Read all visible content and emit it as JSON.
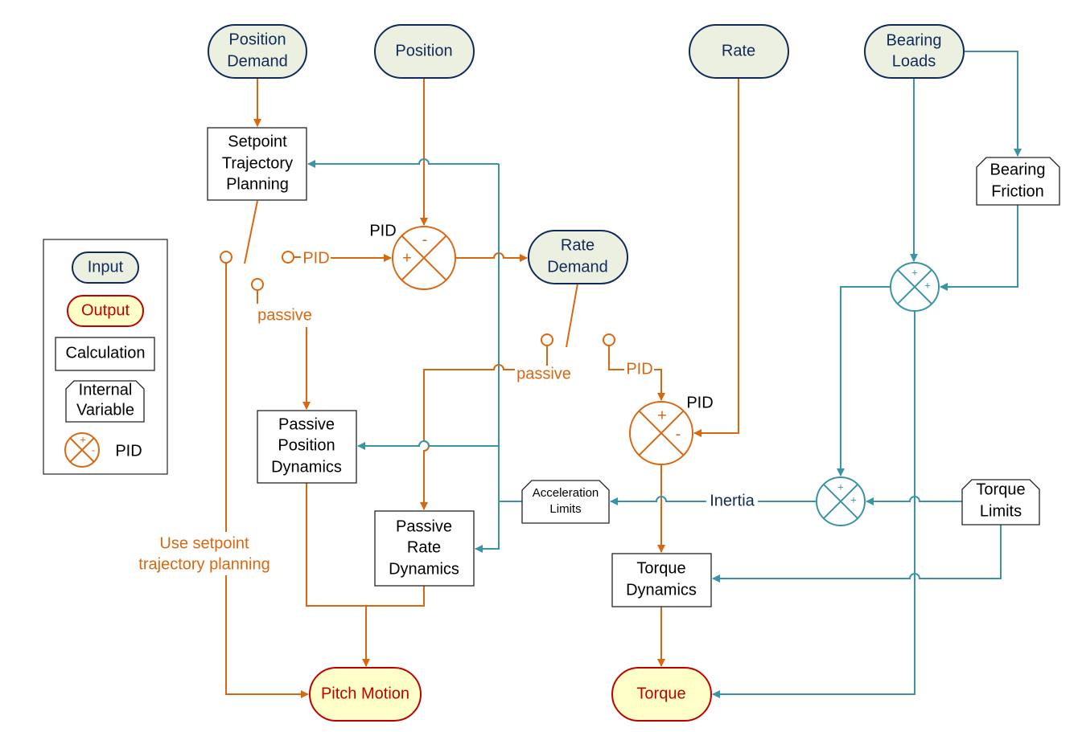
{
  "colors": {
    "control_path": "#D9670F",
    "load_path": "#3A93A8",
    "input_border": "#102A5C",
    "input_fill": "#EBF0E0",
    "output_border": "#C00000",
    "output_fill": "#FFFFC8"
  },
  "inputs": {
    "position_demand": [
      "Position",
      "Demand"
    ],
    "position": "Position",
    "rate": "Rate",
    "bearing_loads": [
      "Bearing",
      "Loads"
    ],
    "rate_demand": [
      "Rate",
      "Demand"
    ]
  },
  "calculations": {
    "setpoint": [
      "Setpoint",
      "Trajectory",
      "Planning"
    ],
    "passive_position": [
      "Passive",
      "Position",
      "Dynamics"
    ],
    "passive_rate": [
      "Passive",
      "Rate",
      "Dynamics"
    ],
    "torque_dynamics": [
      "Torque",
      "Dynamics"
    ]
  },
  "internals": {
    "bearing_friction": [
      "Bearing",
      "Friction"
    ],
    "acceleration_limits": [
      "Acceleration",
      "Limits"
    ],
    "torque_limits": [
      "Torque",
      "Limits"
    ]
  },
  "outputs": {
    "pitch_motion": "Pitch Motion",
    "torque": "Torque"
  },
  "labels": {
    "pid1": "PID",
    "pid2": "PID",
    "switch1_pid": "PID",
    "switch1_passive": "passive",
    "switch2_pid": "PID",
    "switch2_passive": "passive",
    "inertia": "Inertia",
    "use_setpoint": [
      "Use setpoint",
      "trajectory planning"
    ],
    "plus": "+",
    "minus": "-"
  },
  "legend": {
    "input": "Input",
    "output": "Output",
    "calculation": "Calculation",
    "internal": [
      "Internal",
      "Variable"
    ],
    "pid": "PID"
  }
}
